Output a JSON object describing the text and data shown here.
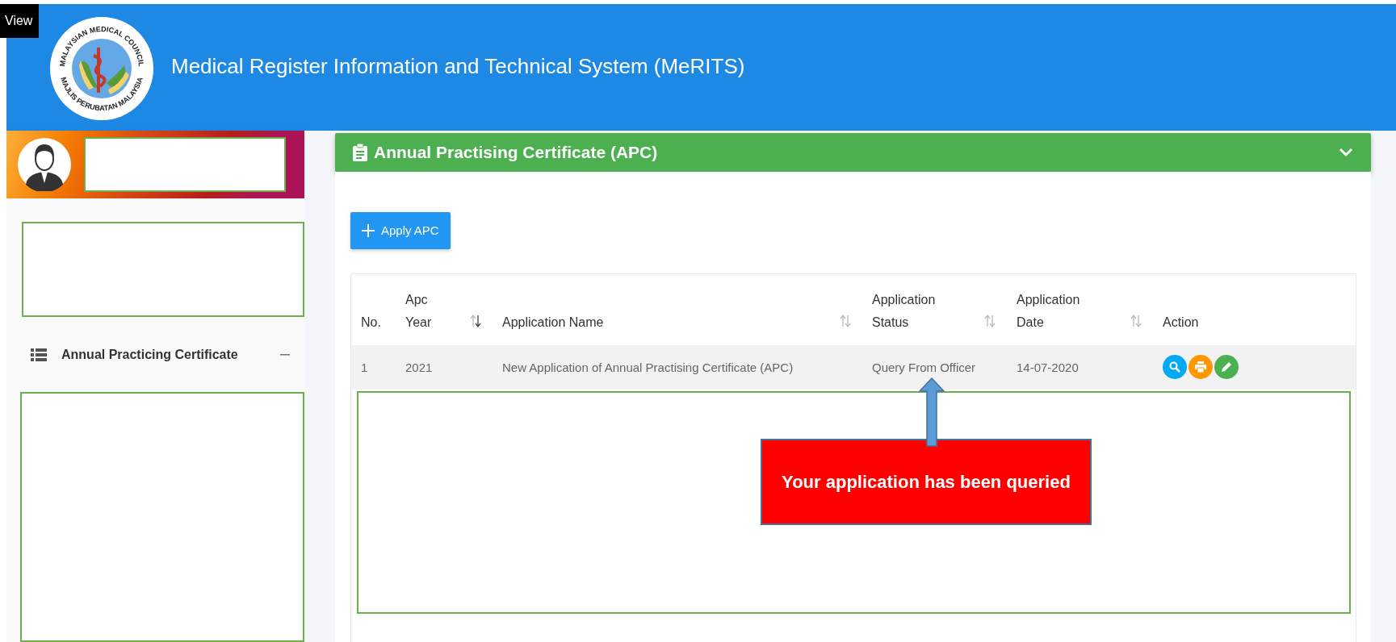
{
  "corner_tag": "View",
  "header": {
    "logo": {
      "top_text": "MALAYSIAN MEDICAL COUNCIL",
      "bottom_text": "MAJLIS PERUBATAN MALAYSIA"
    },
    "title": "Medical Register Information and Technical System (MeRITS)"
  },
  "sidebar": {
    "menu": [
      {
        "label": "Annual Practicing Certificate",
        "expanded": true
      }
    ]
  },
  "card": {
    "title": "Annual Practising Certificate (APC)",
    "collapsed": false,
    "apply_button": "Apply APC",
    "table": {
      "columns": [
        {
          "label": "No.",
          "sortable": false
        },
        {
          "label": "Apc Year",
          "sortable": true
        },
        {
          "label": "Application Name",
          "sortable": true
        },
        {
          "label": "Application Status",
          "sortable": true
        },
        {
          "label": "Application Date",
          "sortable": true
        },
        {
          "label": "Action",
          "sortable": false
        }
      ],
      "rows": [
        {
          "no": "1",
          "year": "2021",
          "name": "New Application of Annual Practising Certificate (APC)",
          "status": "Query From Officer",
          "date": "14-07-2020",
          "actions": [
            {
              "kind": "view",
              "color": "#03a9f4"
            },
            {
              "kind": "print",
              "color": "#ff9800"
            },
            {
              "kind": "edit",
              "color": "#4caf50"
            }
          ]
        }
      ]
    }
  },
  "callout": {
    "text": "Your application has been queried"
  }
}
